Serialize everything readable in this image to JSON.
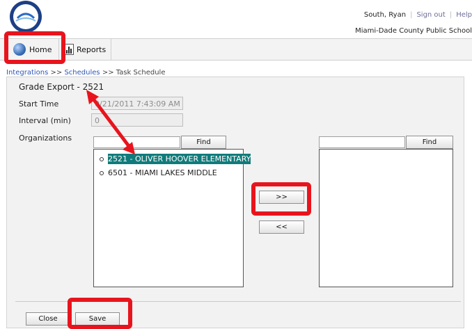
{
  "header": {
    "user_name": "South, Ryan",
    "sign_out": "Sign out",
    "help": "Help",
    "district": "Miami-Dade County Public School"
  },
  "nav": {
    "home": "Home",
    "reports": "Reports"
  },
  "breadcrumb": {
    "integrations": "Integrations",
    "sep1": ">>",
    "schedules": "Schedules",
    "sep2": ">>",
    "current": "Task Schedule"
  },
  "form": {
    "title": "Grade Export - 2521",
    "start_time_label": "Start Time",
    "start_time_value": "0/21/2011 7:43:09 AM",
    "interval_label": "Interval (min)",
    "interval_value": "0",
    "organizations_label": "Organizations",
    "find_label": "Find",
    "move_right_label": ">>",
    "move_left_label": "<<",
    "available_orgs": [
      {
        "label": "2521 - OLIVER HOOVER ELEMENTARY",
        "selected": true
      },
      {
        "label": "6501 - MIAMI LAKES MIDDLE",
        "selected": false
      }
    ],
    "selected_orgs": [],
    "close_label": "Close",
    "save_label": "Save"
  },
  "colors": {
    "annotation": "#e8141d",
    "selection": "#117b7b",
    "link": "#2f56b5"
  }
}
